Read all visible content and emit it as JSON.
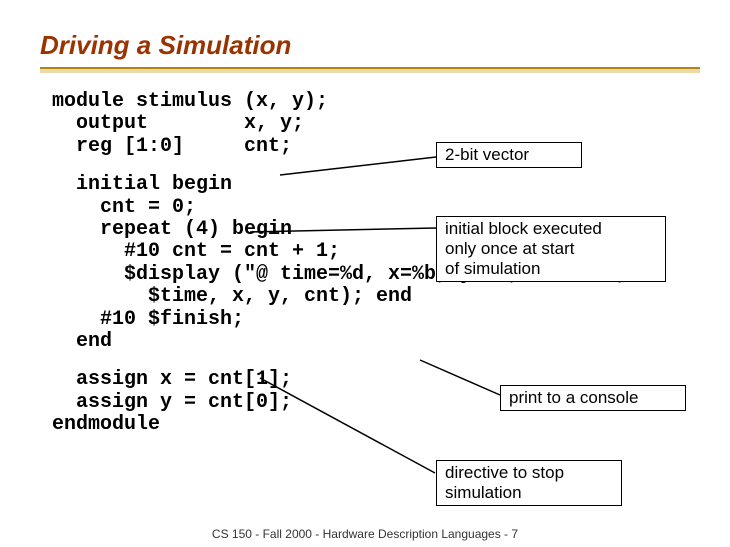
{
  "title": "Driving a Simulation",
  "code": {
    "block1": "module stimulus (x, y);\n  output        x, y;\n  reg [1:0]     cnt;",
    "block2": "  initial begin\n    cnt = 0;\n    repeat (4) begin\n      #10 cnt = cnt + 1;\n      $display (\"@ time=%d, x=%b, y=%b, cnt=%b\",\n        $time, x, y, cnt); end\n    #10 $finish;\n  end",
    "block3": "  assign x = cnt[1];\n  assign y = cnt[0];\nendmodule"
  },
  "annotations": {
    "vector": "2-bit vector",
    "initial": "initial block executed\nonly once at start\nof simulation",
    "print": "print to a console",
    "finish": "directive to stop\nsimulation"
  },
  "footer": "CS 150 - Fall 2000 - Hardware Description Languages - 7"
}
